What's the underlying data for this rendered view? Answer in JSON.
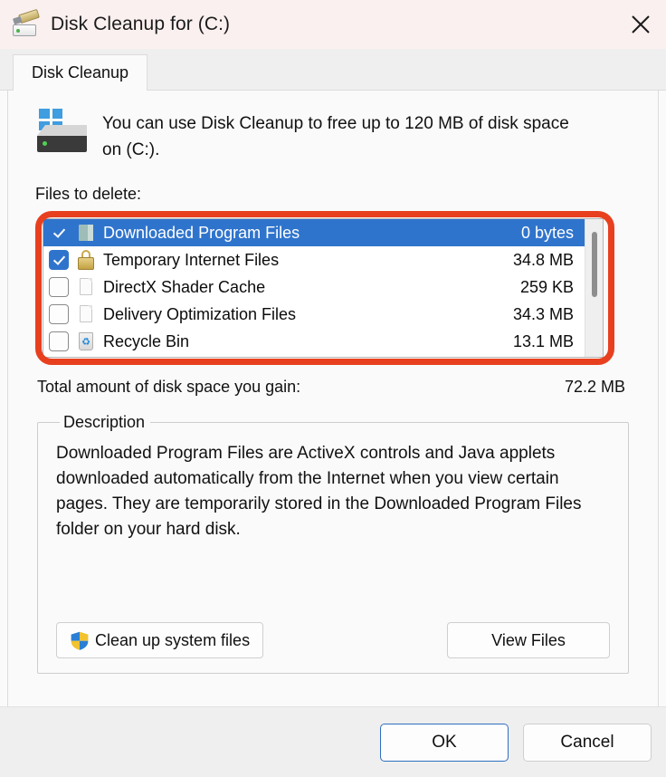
{
  "window": {
    "title": "Disk Cleanup for  (C:)",
    "icon": "disk-cleanup-icon",
    "close_label": "✕"
  },
  "tab": {
    "label": "Disk Cleanup"
  },
  "intro": {
    "icon": "hard-drive-icon",
    "text": "You can use Disk Cleanup to free up to 120 MB of disk space on  (C:)."
  },
  "files_section": {
    "label": "Files to delete:",
    "rows": [
      {
        "label": "Downloaded Program Files",
        "size": "0 bytes",
        "checked": true,
        "selected": true,
        "icon": "folder-icon"
      },
      {
        "label": "Temporary Internet Files",
        "size": "34.8 MB",
        "checked": true,
        "selected": false,
        "icon": "lock-icon"
      },
      {
        "label": "DirectX Shader Cache",
        "size": "259 KB",
        "checked": false,
        "selected": false,
        "icon": "document-icon"
      },
      {
        "label": "Delivery Optimization Files",
        "size": "34.3 MB",
        "checked": false,
        "selected": false,
        "icon": "document-icon"
      },
      {
        "label": "Recycle Bin",
        "size": "13.1 MB",
        "checked": false,
        "selected": false,
        "icon": "recycle-bin-icon"
      },
      {
        "label": "",
        "size": "",
        "checked": true,
        "selected": false,
        "icon": "document-icon"
      }
    ],
    "highlight_color": "#e8401f"
  },
  "total": {
    "label": "Total amount of disk space you gain:",
    "value": "72.2 MB"
  },
  "description": {
    "legend": "Description",
    "text": "Downloaded Program Files are ActiveX controls and Java applets downloaded automatically from the Internet when you view certain pages. They are temporarily stored in the Downloaded Program Files folder on your hard disk.",
    "cleanup_button": "Clean up system files",
    "cleanup_button_icon": "uac-shield-icon",
    "view_button": "View Files"
  },
  "footer": {
    "ok": "OK",
    "cancel": "Cancel"
  },
  "colors": {
    "titlebar": "#faf0ef",
    "selection": "#2f74cc",
    "highlight": "#e8401f",
    "accent_border": "#2f6fc0"
  }
}
